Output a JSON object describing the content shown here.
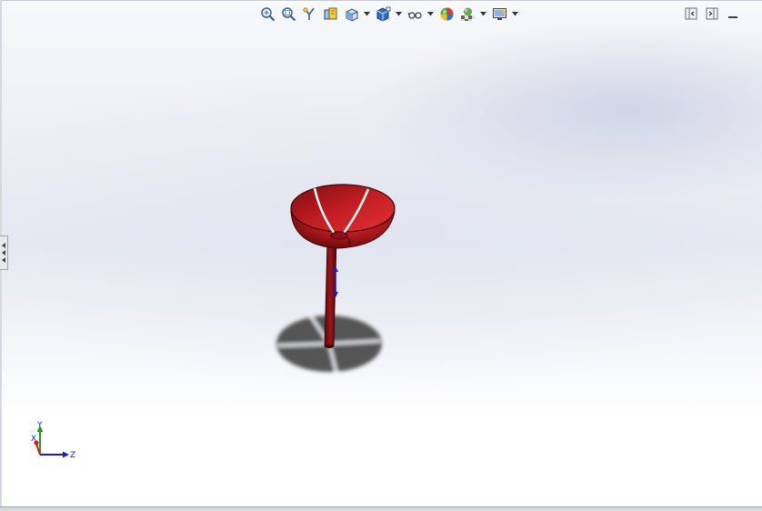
{
  "hud": {
    "tools": [
      {
        "name": "zoom-to-fit-icon",
        "dropdown": false
      },
      {
        "name": "zoom-to-area-icon",
        "dropdown": false
      },
      {
        "name": "previous-view-icon",
        "dropdown": false
      },
      {
        "name": "section-view-icon",
        "dropdown": false
      },
      {
        "name": "view-orientation-icon",
        "dropdown": true
      },
      {
        "name": "display-style-icon",
        "dropdown": true
      },
      {
        "name": "hide-show-items-icon",
        "dropdown": true
      },
      {
        "name": "edit-appearance-icon",
        "dropdown": false
      },
      {
        "name": "apply-scene-icon",
        "dropdown": true
      },
      {
        "name": "view-settings-icon",
        "dropdown": true
      }
    ]
  },
  "window_controls": [
    "split-left-icon",
    "split-right-icon",
    "minimize-icon"
  ],
  "triad": {
    "x": "X",
    "y": "Y",
    "z": "Z"
  },
  "colors": {
    "model": "#a3161a",
    "model_highlight": "#d6272b",
    "shadow": "#5a5a5a",
    "axis_x": "#d01818",
    "axis_y": "#1f9b1f",
    "axis_z": "#1b1bd0"
  }
}
